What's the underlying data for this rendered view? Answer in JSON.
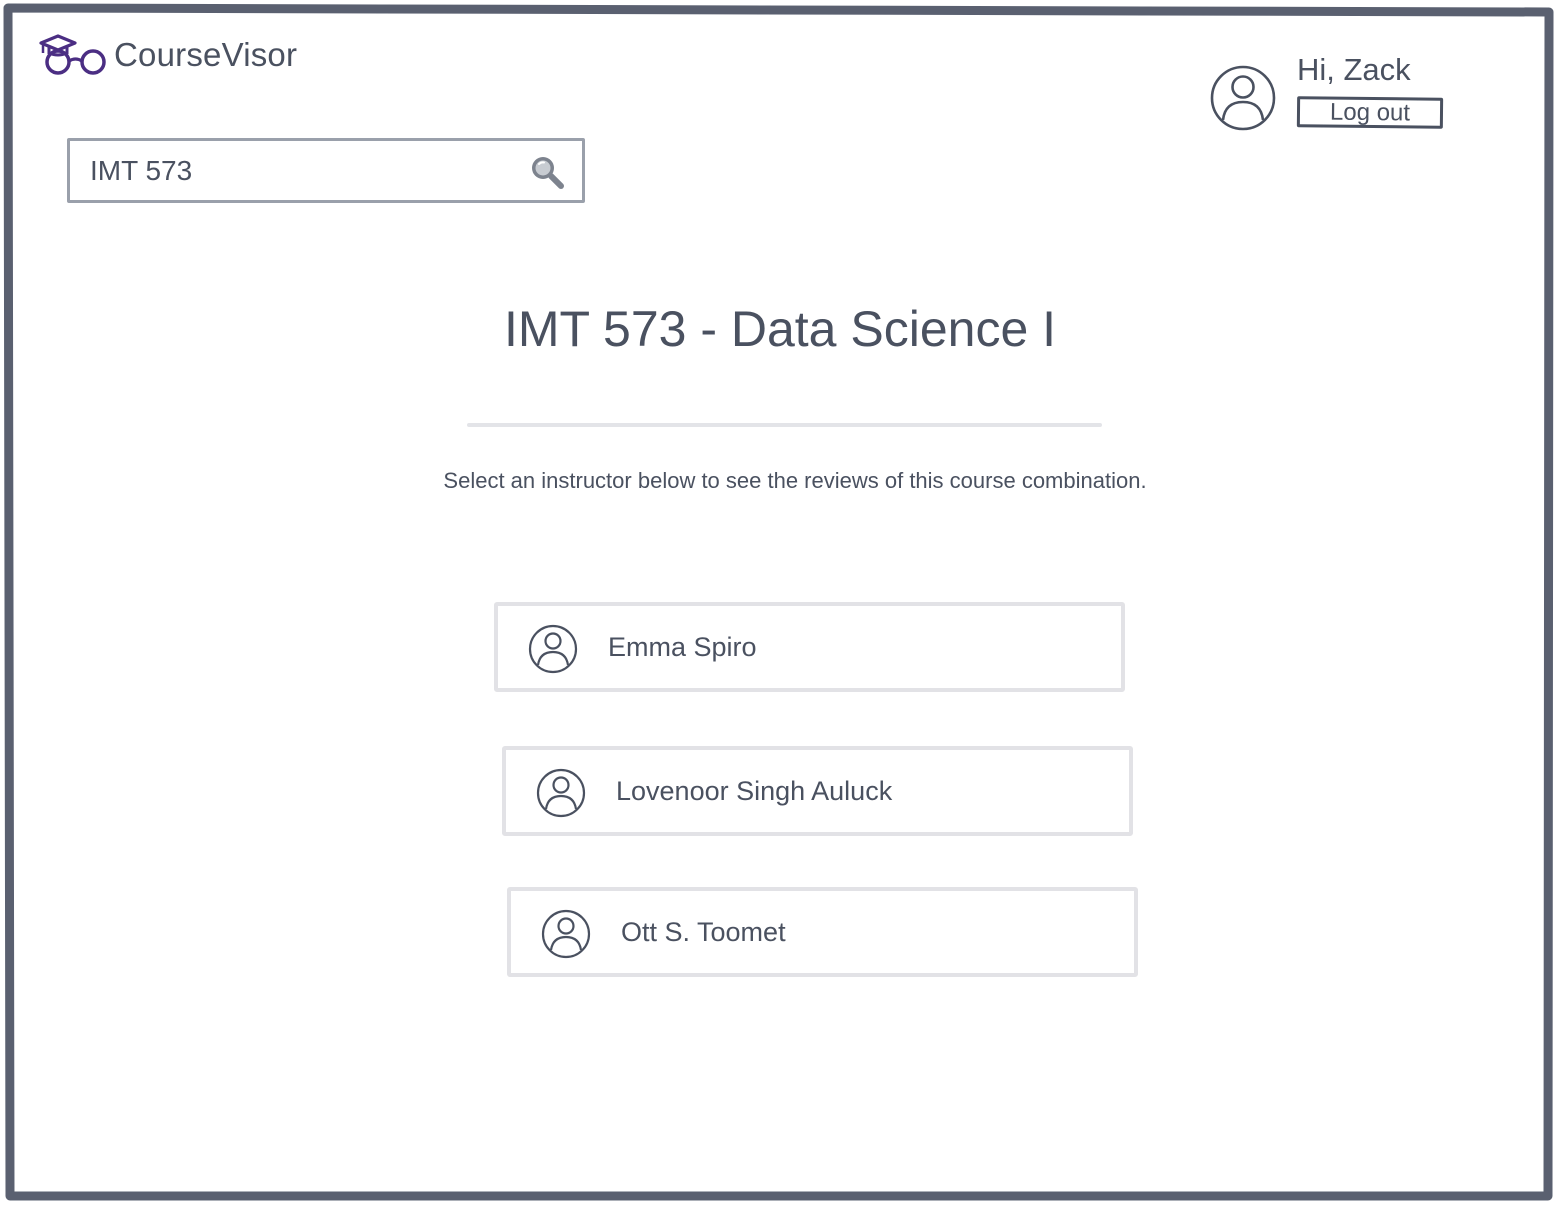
{
  "brand": {
    "name": "CourseVisor",
    "logo_icon": "graduation-cap-glasses-icon",
    "accent_color": "#4b2e83"
  },
  "header": {
    "greeting": "Hi, Zack",
    "logout_label": "Log out",
    "avatar_icon": "user-avatar-icon"
  },
  "search": {
    "value": "IMT 573",
    "icon": "search-icon"
  },
  "main": {
    "title": "IMT 573 - Data Science I",
    "subtitle": "Select an instructor below to see the reviews of this course combination.",
    "instructors": [
      {
        "name": "Emma Spiro",
        "icon": "user-avatar-icon"
      },
      {
        "name": "Lovenoor Singh Auluck",
        "icon": "user-avatar-icon"
      },
      {
        "name": "Ott S. Toomet",
        "icon": "user-avatar-icon"
      }
    ]
  },
  "colors": {
    "text": "#4a5160",
    "frame": "#5a6070",
    "card_border": "#e2e2e6",
    "search_border": "#9aa0ab"
  }
}
